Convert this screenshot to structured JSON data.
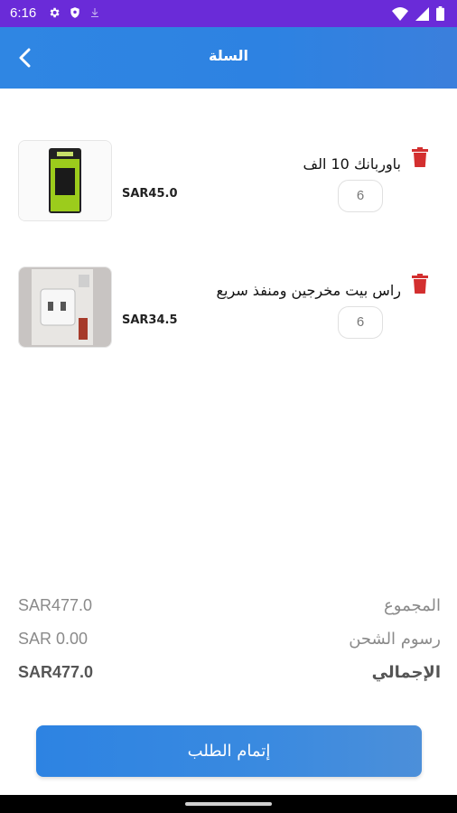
{
  "status_bar": {
    "time": "6:16",
    "icons": [
      "gear-icon",
      "shield-icon",
      "download-icon",
      "wifi-icon",
      "signal-icon",
      "battery-icon"
    ],
    "color": "#6a2bd8"
  },
  "header": {
    "title": "السلة",
    "back_icon": "chevron-left-icon",
    "color": "#2f86e3"
  },
  "cart": {
    "items": [
      {
        "name": "باوربانك 10 الف",
        "price": "SAR45.0",
        "quantity": "6",
        "delete_icon": "trash-icon",
        "image": "powerbank-image"
      },
      {
        "name": "راس بيت مخرجين ومنفذ سريع",
        "price": "SAR34.5",
        "quantity": "6",
        "delete_icon": "trash-icon",
        "image": "wall-charger-image"
      }
    ]
  },
  "summary": {
    "subtotal_label": "المجموع",
    "subtotal_value": "SAR477.0",
    "shipping_label": "رسوم الشحن",
    "shipping_value": "SAR 0.00",
    "total_label": "الإجمالي",
    "total_value": "SAR477.0"
  },
  "checkout": {
    "label": "إتمام الطلب"
  },
  "colors": {
    "accent": "#2f86e3",
    "delete": "#d32f2f"
  }
}
